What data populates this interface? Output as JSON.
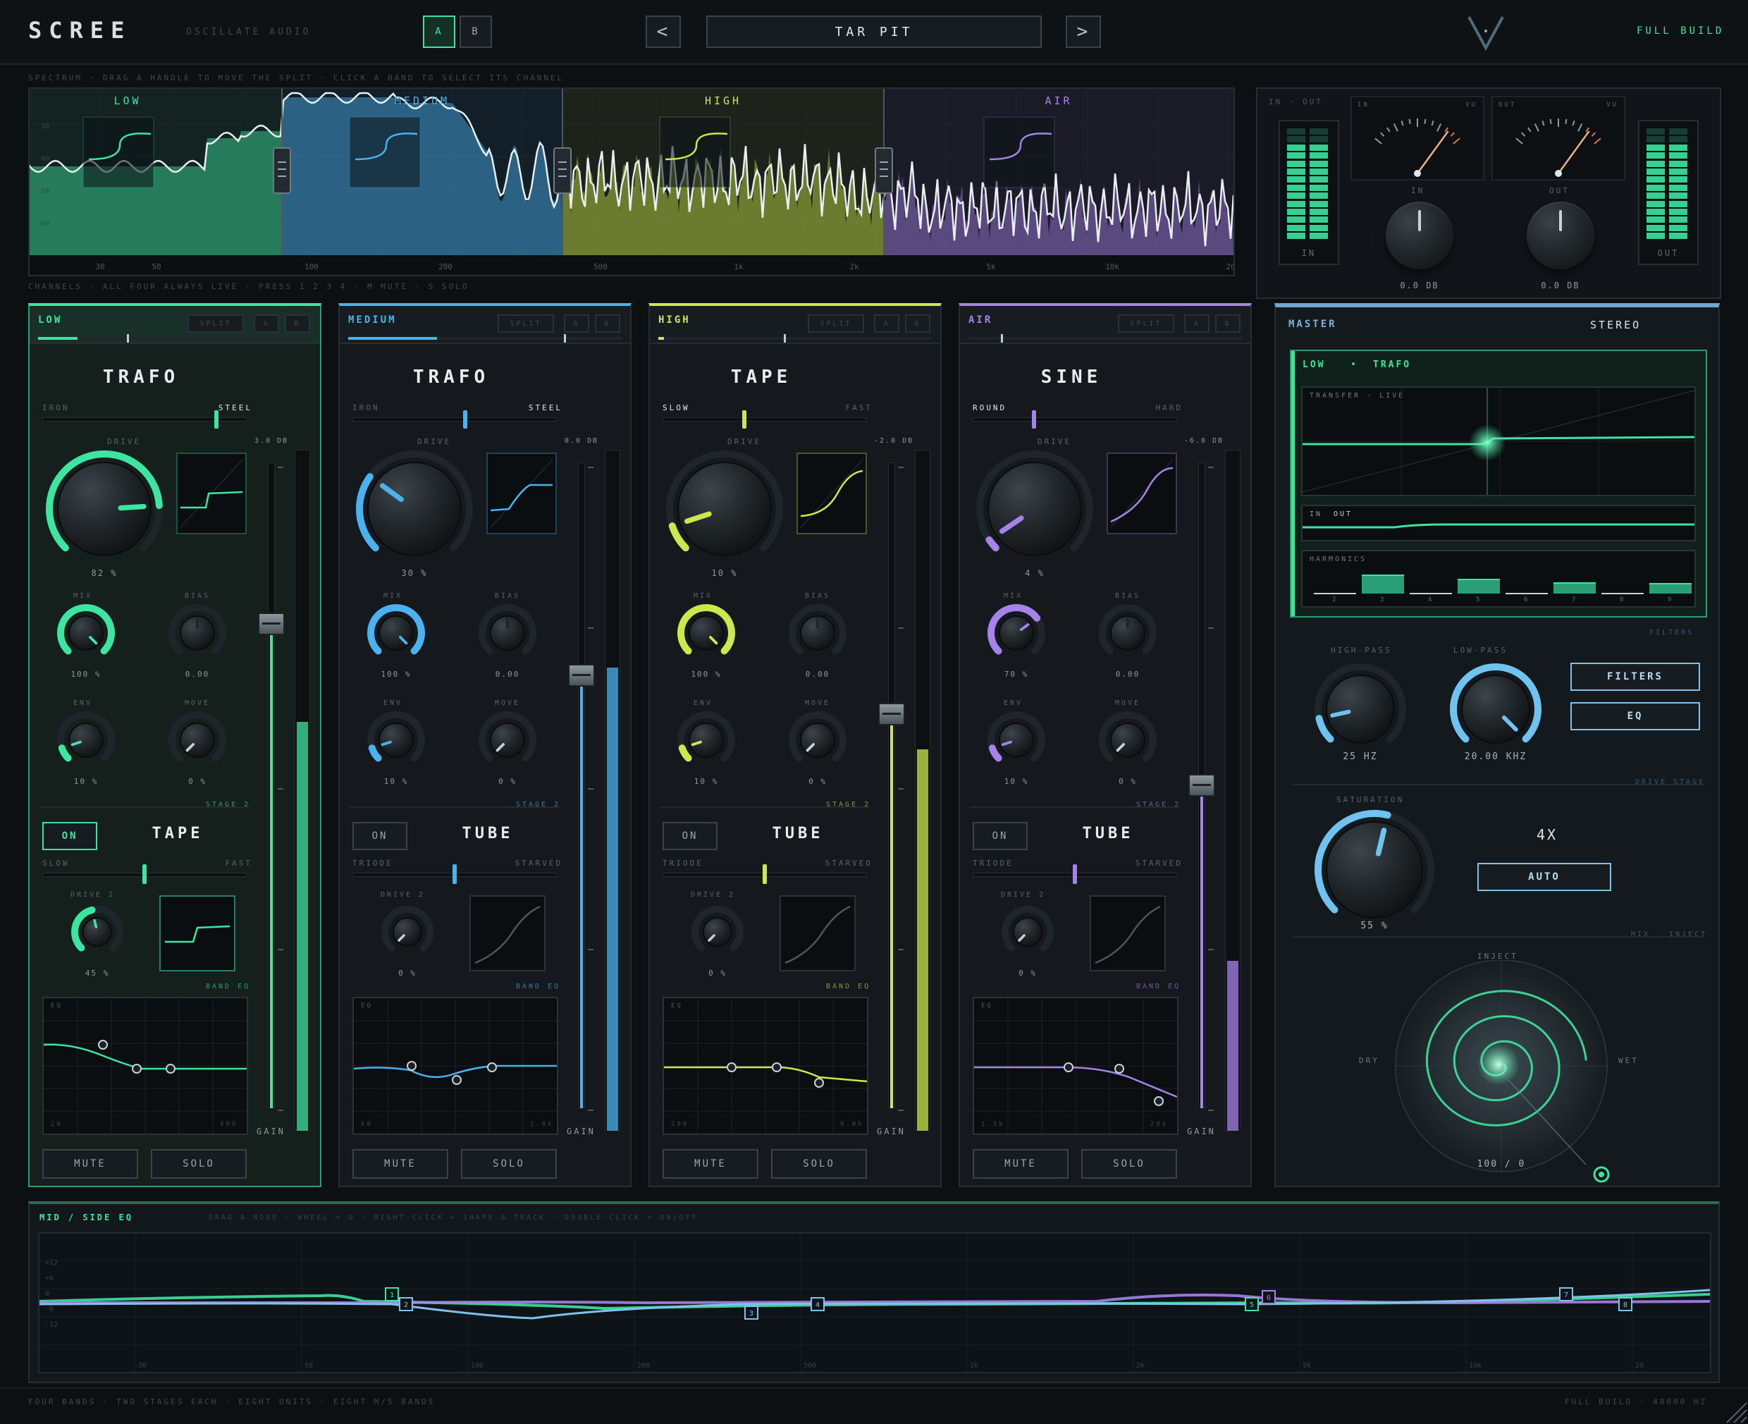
{
  "header": {
    "logo": "SCREE",
    "brand": "OSCILLATE AUDIO",
    "ab": [
      "A",
      "B"
    ],
    "preset": "TAR PIT",
    "build": "FULL BUILD"
  },
  "spectrum": {
    "hint": "SPECTRUM · DRAG A HANDLE TO MOVE THE SPLIT · CLICK A BAND TO SELECT ITS CHANNEL",
    "bands": [
      "LOW",
      "MEDIUM",
      "HIGH",
      "AIR"
    ],
    "freq_labels": [
      "30",
      "50",
      "100",
      "200",
      "500",
      "1k",
      "2k",
      "5k",
      "10k",
      "20"
    ],
    "db_labels": [
      "30",
      "40",
      "50",
      "60"
    ]
  },
  "io": {
    "title": "IN · OUT",
    "in": "IN",
    "out": "OUT",
    "vu": "VU",
    "in_val": "0.0 DB",
    "out_val": "0.0 DB"
  },
  "channels_hint": "CHANNELS · ALL FOUR ALWAYS LIVE · PRESS 1 2 3 4 · M MUTE · S SOLO",
  "colors": {
    "low": "#3de6a0",
    "medium": "#4ab2ef",
    "high": "#cce84a",
    "air": "#a683ea"
  },
  "strips": [
    {
      "band": "LOW",
      "color": "#3de6a0",
      "split": "SPLIT",
      "a": "A",
      "b": "B",
      "unit": "TRAFO",
      "left": "IRON",
      "right": "STEEL",
      "slider": 0.85,
      "drive_label": "DRIVE",
      "drive_val": "82 %",
      "drive": 0.82,
      "gain_db": "3.0 DB",
      "fader": 0.25,
      "meter": 0.6,
      "mix_label": "MIX",
      "mix_val": "100 %",
      "mix": 1.0,
      "bias_label": "BIAS",
      "bias_val": "0.00",
      "env_label": "ENV",
      "env_val": "10 %",
      "env": 0.1,
      "move_label": "MOVE",
      "move_val": "0 %",
      "stage": "STAGE 2",
      "on": "ON",
      "on_active": true,
      "unit2": "TAPE",
      "left2": "SLOW",
      "right2": "FAST",
      "slider2": 0.5,
      "drive2_label": "DRIVE 2",
      "drive2_val": "45 %",
      "drive2": 0.45,
      "band_eq": "BAND EQ",
      "eq_label": "EQ",
      "eq_lo": "20",
      "eq_hi": "400",
      "gain_label": "GAIN",
      "mute": "MUTE",
      "solo": "SOLO"
    },
    {
      "band": "MEDIUM",
      "color": "#4ab2ef",
      "split": "SPLIT",
      "a": "A",
      "b": "B",
      "unit": "TRAFO",
      "left": "IRON",
      "right": "STEEL",
      "slider": 0.55,
      "drive_label": "DRIVE",
      "drive_val": "30 %",
      "drive": 0.3,
      "gain_db": "0.0 DB",
      "fader": 0.33,
      "meter": 0.68,
      "mix_label": "MIX",
      "mix_val": "100 %",
      "mix": 1.0,
      "bias_label": "BIAS",
      "bias_val": "0.00",
      "env_label": "ENV",
      "env_val": "10 %",
      "env": 0.1,
      "move_label": "MOVE",
      "move_val": "0 %",
      "stage": "STAGE 2",
      "on": "ON",
      "on_active": false,
      "unit2": "TUBE",
      "left2": "TRIODE",
      "right2": "STARVED",
      "slider2": 0.5,
      "drive2_label": "DRIVE 2",
      "drive2_val": "0 %",
      "drive2": 0.0,
      "band_eq": "BAND EQ",
      "eq_label": "EQ",
      "eq_lo": "60",
      "eq_hi": "2.0k",
      "gain_label": "GAIN",
      "mute": "MUTE",
      "solo": "SOLO"
    },
    {
      "band": "HIGH",
      "color": "#cce84a",
      "split": "SPLIT",
      "a": "A",
      "b": "B",
      "unit": "TAPE",
      "left": "SLOW",
      "right": "FAST",
      "slider": 0.4,
      "drive_label": "DRIVE",
      "drive_val": "10 %",
      "drive": 0.1,
      "gain_db": "-2.0 DB",
      "fader": 0.39,
      "meter": 0.56,
      "mix_label": "MIX",
      "mix_val": "100 %",
      "mix": 1.0,
      "bias_label": "BIAS",
      "bias_val": "0.00",
      "env_label": "ENV",
      "env_val": "10 %",
      "env": 0.1,
      "move_label": "MOVE",
      "move_val": "0 %",
      "stage": "STAGE 2",
      "on": "ON",
      "on_active": false,
      "unit2": "TUBE",
      "left2": "TRIODE",
      "right2": "STARVED",
      "slider2": 0.5,
      "drive2_label": "DRIVE 2",
      "drive2_val": "0 %",
      "drive2": 0.0,
      "band_eq": "BAND EQ",
      "eq_label": "EQ",
      "eq_lo": "200",
      "eq_hi": "9.0k",
      "gain_label": "GAIN",
      "mute": "MUTE",
      "solo": "SOLO"
    },
    {
      "band": "AIR",
      "color": "#a683ea",
      "split": "SPLIT",
      "a": "A",
      "b": "B",
      "unit": "SINE",
      "left": "ROUND",
      "right": "HARD",
      "slider": 0.3,
      "drive_label": "DRIVE",
      "drive_val": "4 %",
      "drive": 0.04,
      "gain_db": "-6.0 DB",
      "fader": 0.5,
      "meter": 0.25,
      "mix_label": "MIX",
      "mix_val": "70 %",
      "mix": 0.7,
      "bias_label": "BIAS",
      "bias_val": "0.00",
      "env_label": "ENV",
      "env_val": "10 %",
      "env": 0.1,
      "move_label": "MOVE",
      "move_val": "0 %",
      "stage": "STAGE 2",
      "on": "ON",
      "on_active": false,
      "unit2": "TUBE",
      "left2": "TRIODE",
      "right2": "STARVED",
      "slider2": 0.5,
      "drive2_label": "DRIVE 2",
      "drive2_val": "0 %",
      "drive2": 0.0,
      "band_eq": "BAND EQ",
      "eq_label": "EQ",
      "eq_lo": "1.5k",
      "eq_hi": "20k",
      "gain_label": "GAIN",
      "mute": "MUTE",
      "solo": "SOLO"
    }
  ],
  "master": {
    "title": "MASTER",
    "mode": "STEREO",
    "sel_band": "LOW",
    "sel_dot": "•",
    "sel_unit": "TRAFO",
    "transfer": "TRANSFER · LIVE",
    "in": "IN",
    "out": "OUT",
    "harmonics": "HARMONICS",
    "harm_labels": [
      "2",
      "3",
      "4",
      "5",
      "6",
      "7",
      "8",
      "9"
    ],
    "harm_levels": [
      0.05,
      0.9,
      0.05,
      0.7,
      0.05,
      0.55,
      0.05,
      0.5
    ],
    "filters_section": "FILTERS",
    "hp_label": "HIGH-PASS",
    "hp_val": "25 HZ",
    "hp": 0.12,
    "lp_label": "LOW-PASS",
    "lp_val": "20.00 KHZ",
    "lp": 1.0,
    "filters_btn": "FILTERS",
    "eq_btn": "EQ",
    "drive_stage": "DRIVE STAGE",
    "sat_label": "SATURATION",
    "sat_val": "55 %",
    "sat": 0.55,
    "oversample": "4X",
    "auto": "AUTO",
    "mix_inject": "MIX · INJECT",
    "inject": "INJECT",
    "dry": "DRY",
    "wet": "WET",
    "orb_val": "100 / 0"
  },
  "ms_eq": {
    "title": "MID / SIDE EQ",
    "hint": "DRAG A NODE · WHEEL = Q · RIGHT-CLICK = SHAPE & TRACK · DOUBLE-CLICK = ON/OFF",
    "db_labels": [
      "+12",
      "+6",
      "0",
      "-6",
      "-12"
    ],
    "freq_labels": [
      "30",
      "50",
      "100",
      "200",
      "500",
      "1k",
      "2k",
      "5k",
      "10k",
      "20"
    ],
    "nodes": [
      {
        "label": "1"
      },
      {
        "label": "2"
      },
      {
        "label": "3"
      },
      {
        "label": "4"
      },
      {
        "label": "5"
      },
      {
        "label": "6"
      },
      {
        "label": "7"
      },
      {
        "label": "8"
      }
    ]
  },
  "footer": {
    "left": "FOUR BANDS · TWO STAGES EACH · EIGHT UNITS · EIGHT M/S BANDS",
    "right": "FULL BUILD · 48000 HZ"
  }
}
